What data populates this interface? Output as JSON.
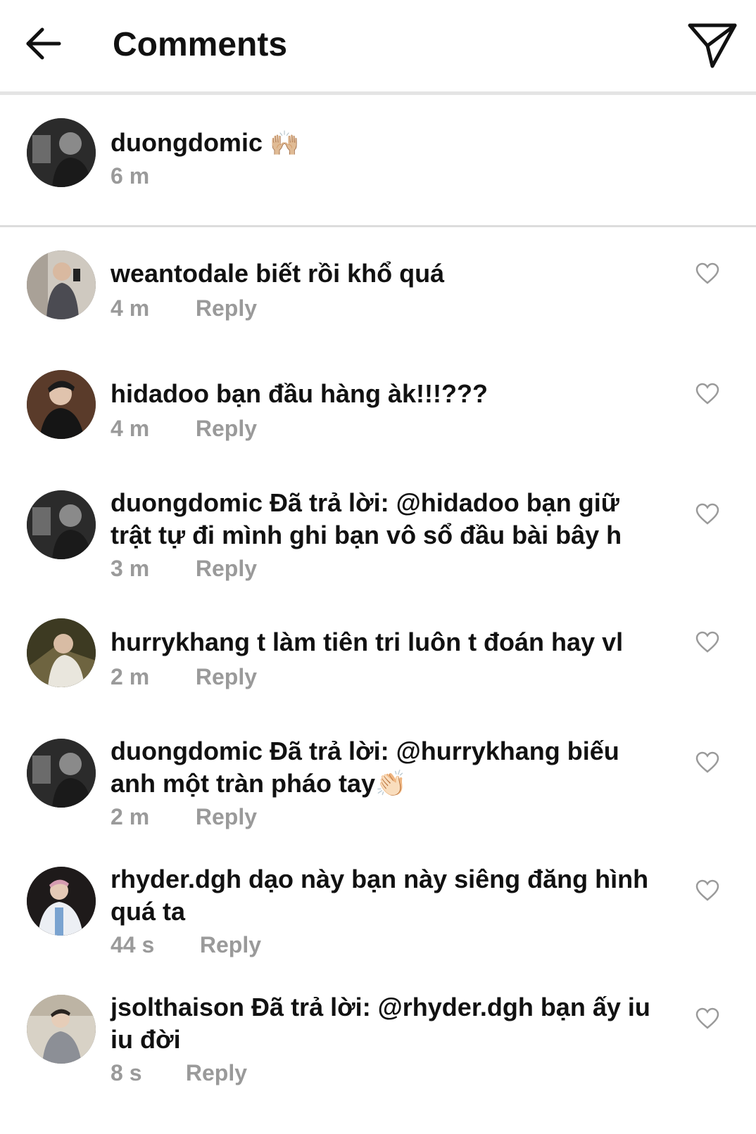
{
  "header": {
    "title": "Comments",
    "back_icon": "arrow-left-icon",
    "send_icon": "paper-plane-icon"
  },
  "caption": {
    "username": "duongdomic",
    "text": "🙌🏼",
    "time": "6 m"
  },
  "reply_label": "Reply",
  "comments": [
    {
      "username": "weantodale",
      "text": "biết rồi khổ quá",
      "time": "4 m"
    },
    {
      "username": "hidadoo",
      "text": "bạn đầu hàng àk!!!???",
      "time": "4 m"
    },
    {
      "username": "duongdomic",
      "text": "Đã trả lời: @hidadoo bạn giữ trật tự đi mình ghi bạn vô sổ đầu bài bây h",
      "time": "3 m"
    },
    {
      "username": "hurrykhang",
      "text": "t làm tiên tri luôn t đoán hay vl",
      "time": "2 m"
    },
    {
      "username": "duongdomic",
      "text": "Đã trả lời: @hurrykhang biếu anh một tràn pháo tay👏🏻",
      "time": "2 m"
    },
    {
      "username": "rhyder.dgh",
      "text": "dạo này bạn này siêng đăng hình quá ta",
      "time": "44 s"
    },
    {
      "username": "jsolthaison",
      "text": "Đã trả lời: @rhyder.dgh bạn ấy iu iu đời",
      "time": "8 s"
    }
  ],
  "colors": {
    "text": "#111111",
    "meta": "#9a9a9a",
    "divider": "#e4e4e4",
    "heart": "#9a9a9a"
  }
}
